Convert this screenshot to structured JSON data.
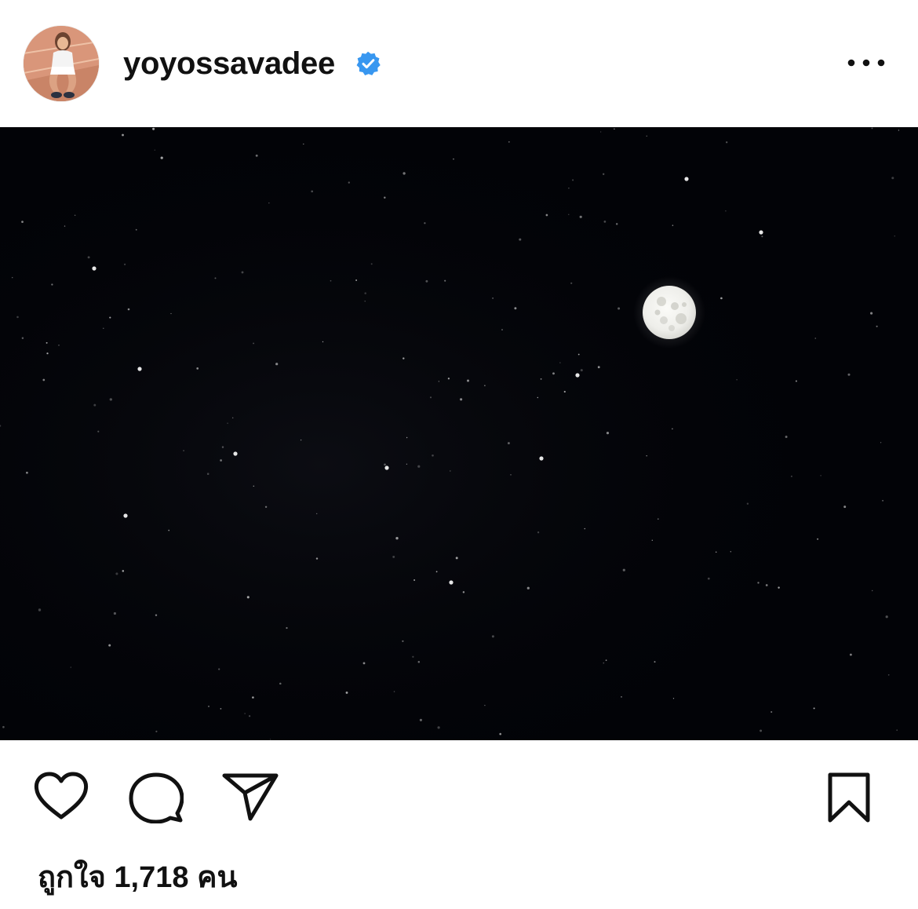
{
  "post": {
    "username": "yoyossavadee",
    "verified": true,
    "icons": {
      "avatar": "profile-photo",
      "verified": "verified-badge-icon",
      "more": "more-horizontal-icon",
      "like": "heart-icon",
      "comment": "comment-bubble-icon",
      "share": "paper-plane-icon",
      "save": "bookmark-icon"
    },
    "image": {
      "description_type": "night-sky-full-moon"
    },
    "likes": {
      "prefix": "ถูกใจ",
      "count": "1,718",
      "suffix": "คน"
    }
  },
  "colors": {
    "verified_blue": "#3897f0",
    "text": "#111111",
    "sky": "#020307"
  }
}
